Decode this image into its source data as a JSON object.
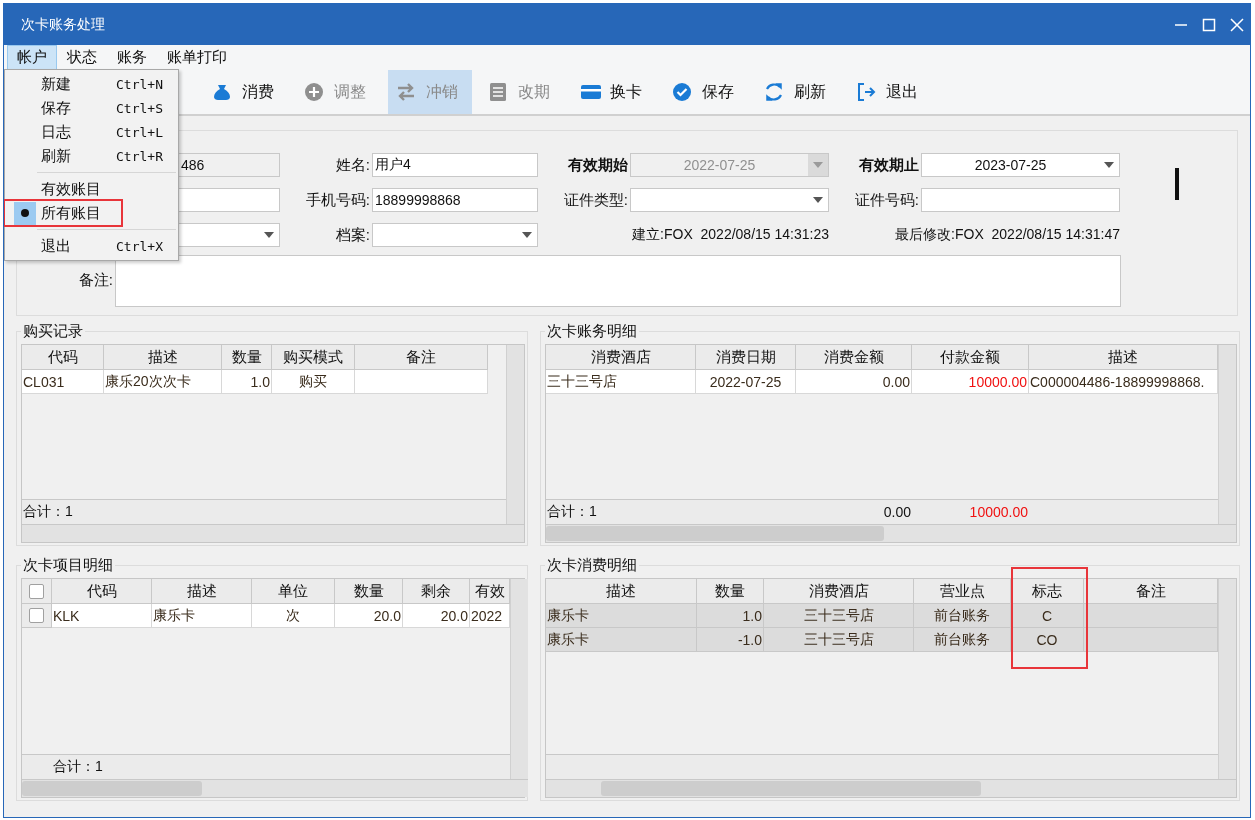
{
  "window": {
    "title": "次卡账务处理"
  },
  "menu_bar": [
    {
      "label": "帐户",
      "selected": true
    },
    {
      "label": "状态",
      "selected": false
    },
    {
      "label": "账务",
      "selected": false
    },
    {
      "label": "账单打印",
      "selected": false
    }
  ],
  "account_menu": [
    {
      "kind": "command",
      "label": "新建",
      "shortcut": "Ctrl+N"
    },
    {
      "kind": "command",
      "label": "保存",
      "shortcut": "Ctrl+S"
    },
    {
      "kind": "command",
      "label": "日志",
      "shortcut": "Ctrl+L"
    },
    {
      "kind": "command",
      "label": "刷新",
      "shortcut": "Ctrl+R"
    },
    {
      "kind": "separator"
    },
    {
      "kind": "option",
      "label": "有效账目",
      "selected": false,
      "annotated": false
    },
    {
      "kind": "option",
      "label": "所有账目",
      "selected": true,
      "annotated": true
    },
    {
      "kind": "separator"
    },
    {
      "kind": "command",
      "label": "退出",
      "shortcut": "Ctrl+X"
    }
  ],
  "toolbar": [
    {
      "label": "消费",
      "disabled": false,
      "hot": false
    },
    {
      "label": "调整",
      "disabled": true,
      "hot": false
    },
    {
      "label": "冲销",
      "disabled": true,
      "hot": true
    },
    {
      "label": "改期",
      "disabled": true,
      "hot": false
    },
    {
      "label": "换卡",
      "disabled": false,
      "hot": false
    },
    {
      "label": "保存",
      "disabled": false,
      "hot": false
    },
    {
      "label": "刷新",
      "disabled": false,
      "hot": false
    },
    {
      "label": "退出",
      "disabled": false,
      "hot": false
    }
  ],
  "form": {
    "rows": [
      [
        {
          "kind": "field",
          "value": "486",
          "readonly": true
        },
        {
          "kind": "label",
          "text": "姓名:",
          "bold": false
        },
        {
          "kind": "field",
          "value": "用户4",
          "readonly": false
        },
        {
          "kind": "label",
          "text": "有效期始",
          "bold": true
        },
        {
          "kind": "combo",
          "value": "2022-07-25",
          "disabled": true
        },
        {
          "kind": "label",
          "text": "有效期止",
          "bold": true
        },
        {
          "kind": "combo",
          "value": "2023-07-25",
          "disabled": false
        }
      ],
      [
        {
          "kind": "field",
          "readonly": false
        },
        {
          "kind": "label",
          "text": "手机号码:",
          "bold": false
        },
        {
          "kind": "field",
          "value": "18899998868",
          "readonly": false
        },
        {
          "kind": "label",
          "text": "证件类型:",
          "bold": false
        },
        {
          "kind": "combo",
          "disabled": false
        },
        {
          "kind": "label",
          "text": "证件号码:",
          "bold": false
        },
        {
          "kind": "field",
          "readonly": false
        }
      ],
      [
        {
          "kind": "combo",
          "disabled": false
        },
        {
          "kind": "label",
          "text": "档案:",
          "bold": false
        },
        {
          "kind": "combo",
          "disabled": false
        }
      ]
    ],
    "audit": {
      "created": "建立:FOX  2022/08/15 14:31:23",
      "modified": "最后修改:FOX  2022/08/15 14:31:47"
    },
    "remarks": {
      "label": "备注:"
    }
  },
  "purchase_records": {
    "title": "购买记录",
    "columns": [
      {
        "label": "代码",
        "annotated": false
      },
      {
        "label": "描述",
        "annotated": false
      },
      {
        "label": "数量",
        "annotated": false
      },
      {
        "label": "购买模式",
        "annotated": false
      },
      {
        "label": "备注",
        "annotated": false
      }
    ],
    "rows": [
      {
        "cells": [
          "CL031",
          "康乐20次次卡",
          "1.0",
          "购买"
        ]
      }
    ],
    "footer": {
      "count": "合计：1"
    }
  },
  "account_details": {
    "title": "次卡账务明细",
    "columns": [
      {
        "label": "消费酒店",
        "annotated": false
      },
      {
        "label": "消费日期",
        "annotated": false
      },
      {
        "label": "消费金额",
        "annotated": false
      },
      {
        "label": "付款金额",
        "annotated": false
      },
      {
        "label": "描述",
        "annotated": false
      }
    ],
    "rows": [
      {
        "cells": [
          "三十三号店",
          "2022-07-25",
          "0.00",
          "10000.00",
          "C000004486-18899998868."
        ]
      }
    ],
    "footer": {
      "count": "合计：1",
      "totals": [
        "0.00",
        "10000.00"
      ]
    }
  },
  "card_items": {
    "title": "次卡项目明细",
    "header_checkbox": {
      "checked": false
    },
    "columns": [
      {
        "label": "代码",
        "annotated": false
      },
      {
        "label": "描述",
        "annotated": false
      },
      {
        "label": "单位",
        "annotated": false
      },
      {
        "label": "数量",
        "annotated": false
      },
      {
        "label": "剩余",
        "annotated": false
      },
      {
        "label": "有效",
        "annotated": false
      }
    ],
    "rows": [
      {
        "checked": false,
        "cells": [
          "KLK",
          "康乐卡",
          "次",
          "20.0",
          "20.0",
          "2022"
        ]
      }
    ],
    "footer": {
      "count": "合计：1"
    }
  },
  "consumption_details": {
    "title": "次卡消费明细",
    "columns": [
      {
        "label": "描述",
        "annotated": false
      },
      {
        "label": "数量",
        "annotated": false
      },
      {
        "label": "消费酒店",
        "annotated": false
      },
      {
        "label": "营业点",
        "annotated": false
      },
      {
        "label": "标志",
        "annotated": true
      },
      {
        "label": "备注",
        "annotated": false
      }
    ],
    "rows": [
      {
        "cells": [
          "康乐卡",
          "1.0",
          "三十三号店",
          "前台账务",
          "C"
        ]
      },
      {
        "cells": [
          "康乐卡",
          "-1.0",
          "三十三号店",
          "前台账务",
          "CO"
        ]
      }
    ]
  }
}
